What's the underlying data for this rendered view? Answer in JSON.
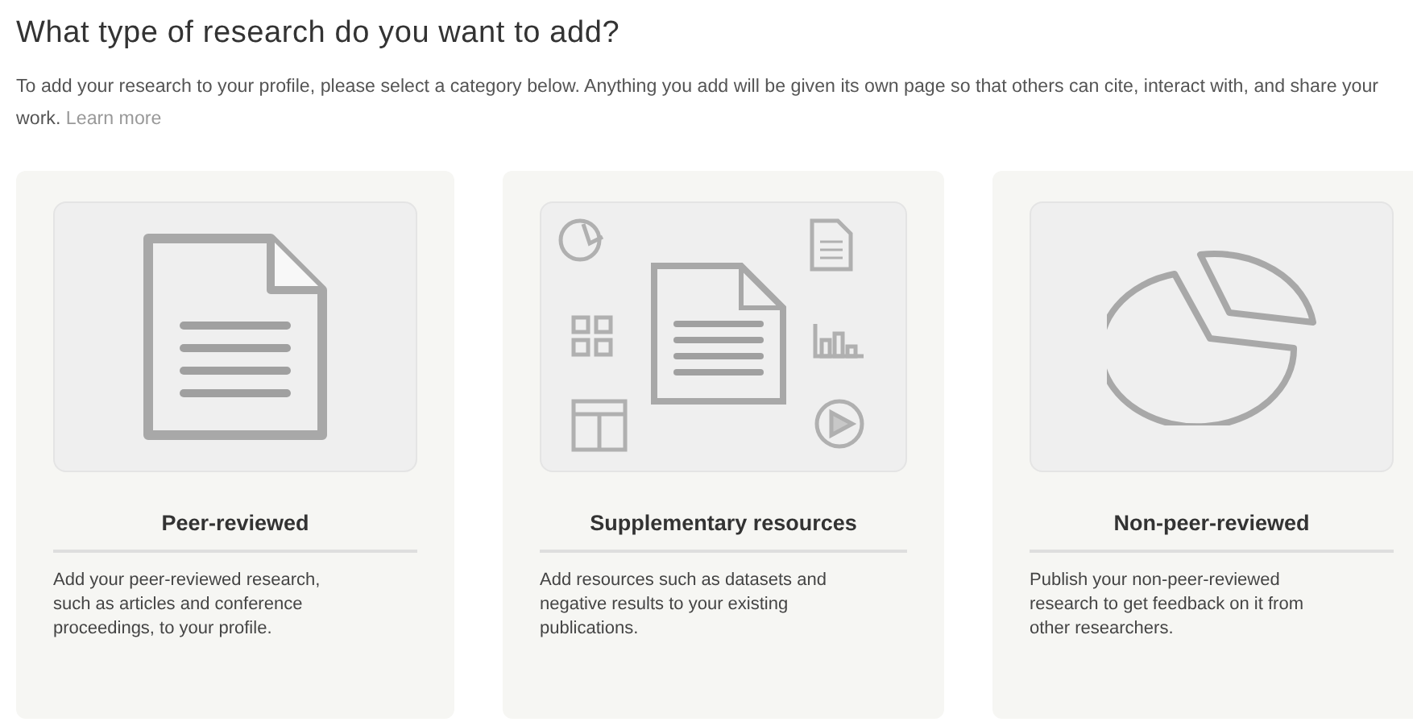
{
  "heading": "What type of research do you want to add?",
  "intro": {
    "text": "To add your research to your profile, please select a category below. Anything you add will be given its own page so that others can cite, interact with, and share your work.",
    "link": "Learn more"
  },
  "cards": [
    {
      "kind": "document",
      "title": "Peer-reviewed",
      "description": "Add your peer-reviewed research, such as articles and conference proceedings, to your profile."
    },
    {
      "kind": "resources",
      "title": "Supplementary resources",
      "description": "Add resources such as datasets and negative results to your existing publications."
    },
    {
      "kind": "pie",
      "title": "Non-peer-reviewed",
      "description": "Publish your non-peer-reviewed research to get feedback on it from other researchers."
    }
  ]
}
